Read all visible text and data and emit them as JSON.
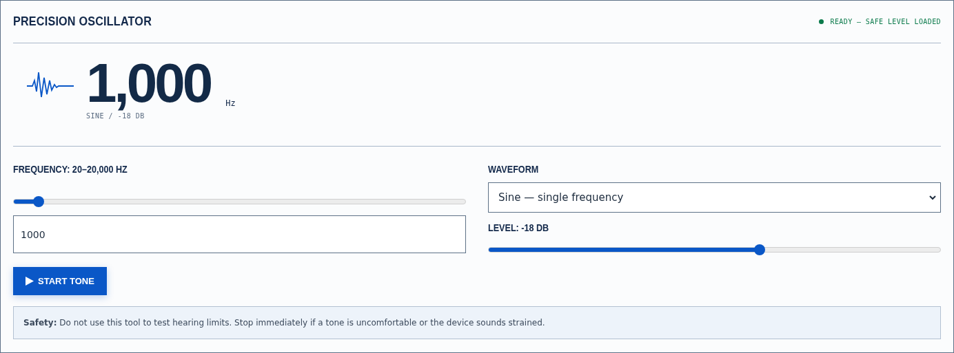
{
  "header": {
    "title": "PRECISION OSCILLATOR",
    "status": {
      "text": "READY — SAFE LEVEL LOADED",
      "color": "#0b7a4b"
    }
  },
  "readout": {
    "value": "1,000",
    "unit": "Hz",
    "detail": "SINE / -18 DB"
  },
  "frequency": {
    "label": "FREQUENCY: 20–20,000 HZ",
    "level": 0.055,
    "value": "1000"
  },
  "waveform": {
    "label": "WAVEFORM",
    "value": "Sine — single frequency"
  },
  "output_level": {
    "label": "LEVEL: -18 DB",
    "level": 0.6
  },
  "start_button": {
    "label": "START TONE"
  },
  "notice": {
    "text": "**Safety:** Do not use this tool to test hearing limits. Stop immediately if a tone is uncomfortable or the device sounds strained."
  }
}
